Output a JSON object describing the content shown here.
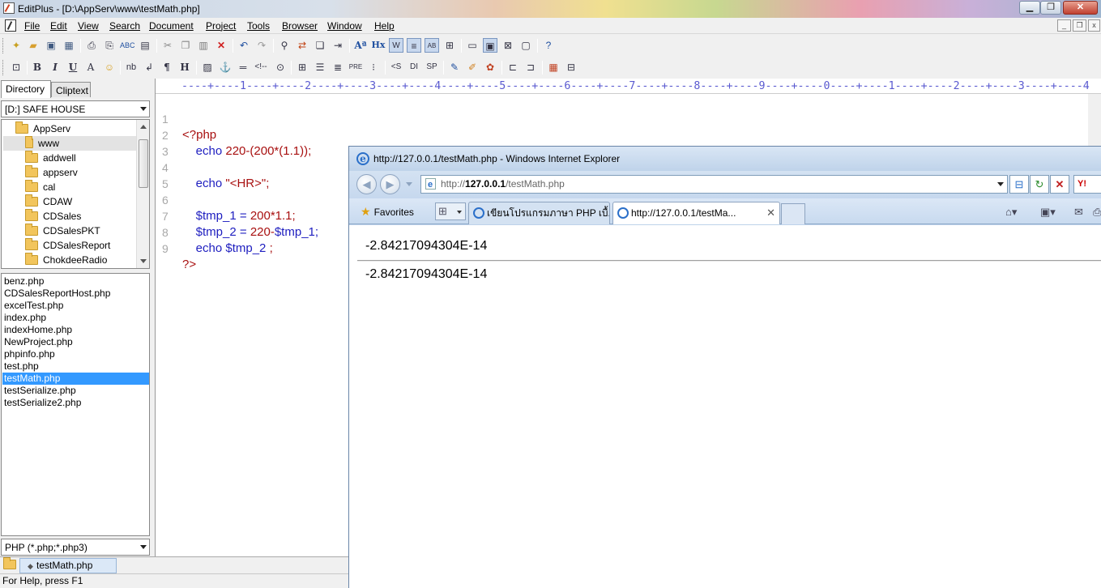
{
  "window": {
    "title": "EditPlus - [D:\\AppServ\\www\\testMath.php]",
    "min_glyph": "▁",
    "max_glyph": "❐",
    "close_glyph": "✕"
  },
  "menu": {
    "items": [
      "File",
      "Edit",
      "View",
      "Search",
      "Document",
      "Project",
      "Tools",
      "Browser",
      "Window",
      "Help"
    ]
  },
  "toolbar1": {
    "buttons": [
      "new-file-icon",
      "open-icon",
      "save-icon",
      "save-all-icon",
      "print-preview-icon",
      "print-icon",
      "spell-check-icon",
      "file-list-icon",
      "cut-icon",
      "copy-icon",
      "paste-icon",
      "delete-icon",
      "undo-icon",
      "redo-icon",
      "find-icon",
      "replace-icon",
      "find-in-files-icon",
      "goto-icon",
      "font-size-icon",
      "hex-icon",
      "word-wrap-icon",
      "line-number-icon",
      "column-icon",
      "ruler-icon",
      "view-icon",
      "fullscreen-icon",
      "cliptext-icon",
      "directory-icon",
      "help-icon"
    ]
  },
  "toolbar2": {
    "bold": "B",
    "italic": "I",
    "underline": "U",
    "font": "A",
    "nbsp": "nb",
    "br": "↲",
    "para": "¶",
    "heading": "H",
    "pre": "PRE",
    "comment": "<S",
    "di": "DI",
    "sp": "SP"
  },
  "left_panel": {
    "tabs": [
      "Directory",
      "Cliptext"
    ],
    "drive": "[D:] SAFE HOUSE",
    "folders": [
      "AppServ",
      "www",
      "addwell",
      "appserv",
      "cal",
      "CDAW",
      "CDSales",
      "CDSalesPKT",
      "CDSalesReport",
      "ChokdeeRadio"
    ],
    "selected_folder": "www",
    "files": [
      "benz.php",
      "CDSalesReportHost.php",
      "excelTest.php",
      "index.php",
      "indexHome.php",
      "NewProject.php",
      "phpinfo.php",
      "test.php",
      "testMath.php",
      "testSerialize.php",
      "testSerialize2.php"
    ],
    "selected_file": "testMath.php",
    "filter": "PHP (*.php;*.php3)"
  },
  "editor": {
    "ruler": "----+----1----+----2----+----3----+----4----+----5----+----6----+----7----+----8----+----9----+----0----+----1----+----2----+----3----+----4",
    "lines": [
      {
        "num": "1",
        "parts": [
          "<?php",
          "",
          "",
          ""
        ]
      },
      {
        "num": "2",
        "parts": [
          "    echo ",
          "220-(200*(1.1));",
          "",
          ""
        ]
      },
      {
        "num": "3",
        "parts": [
          "",
          "",
          "",
          ""
        ]
      },
      {
        "num": "4",
        "parts": [
          "    echo ",
          "\"<HR>\";",
          "",
          ""
        ]
      },
      {
        "num": "5",
        "parts": [
          "",
          "",
          "",
          ""
        ]
      },
      {
        "num": "6",
        "parts": [
          "    $tmp_1",
          " = ",
          "200*1.1;",
          ""
        ]
      },
      {
        "num": "7",
        "parts": [
          "    $tmp_2",
          " = ",
          "220-",
          "$tmp_1;"
        ]
      },
      {
        "num": "8",
        "parts": [
          "    echo $tmp_2",
          " ;",
          "",
          ""
        ]
      },
      {
        "num": "9",
        "parts": [
          "?>",
          "",
          "",
          ""
        ]
      }
    ]
  },
  "doc_tab": {
    "label": "testMath.php",
    "marker": "◆"
  },
  "status": {
    "text": "For Help, press F1"
  },
  "ie": {
    "title": "http://127.0.0.1/testMath.php - Windows Internet Explorer",
    "url_prefix": "http://",
    "url_host": "127.0.0.1",
    "url_path": "/testMath.php",
    "favorites": "Favorites",
    "tabs": [
      "เขียนโปรแกรมภาษา PHP เบื้...",
      "http://127.0.0.1/testMa..."
    ],
    "tab_close": "✕",
    "search_label": "Y!",
    "output": [
      "-2.84217094304E-14",
      "-2.84217094304E-14"
    ]
  }
}
